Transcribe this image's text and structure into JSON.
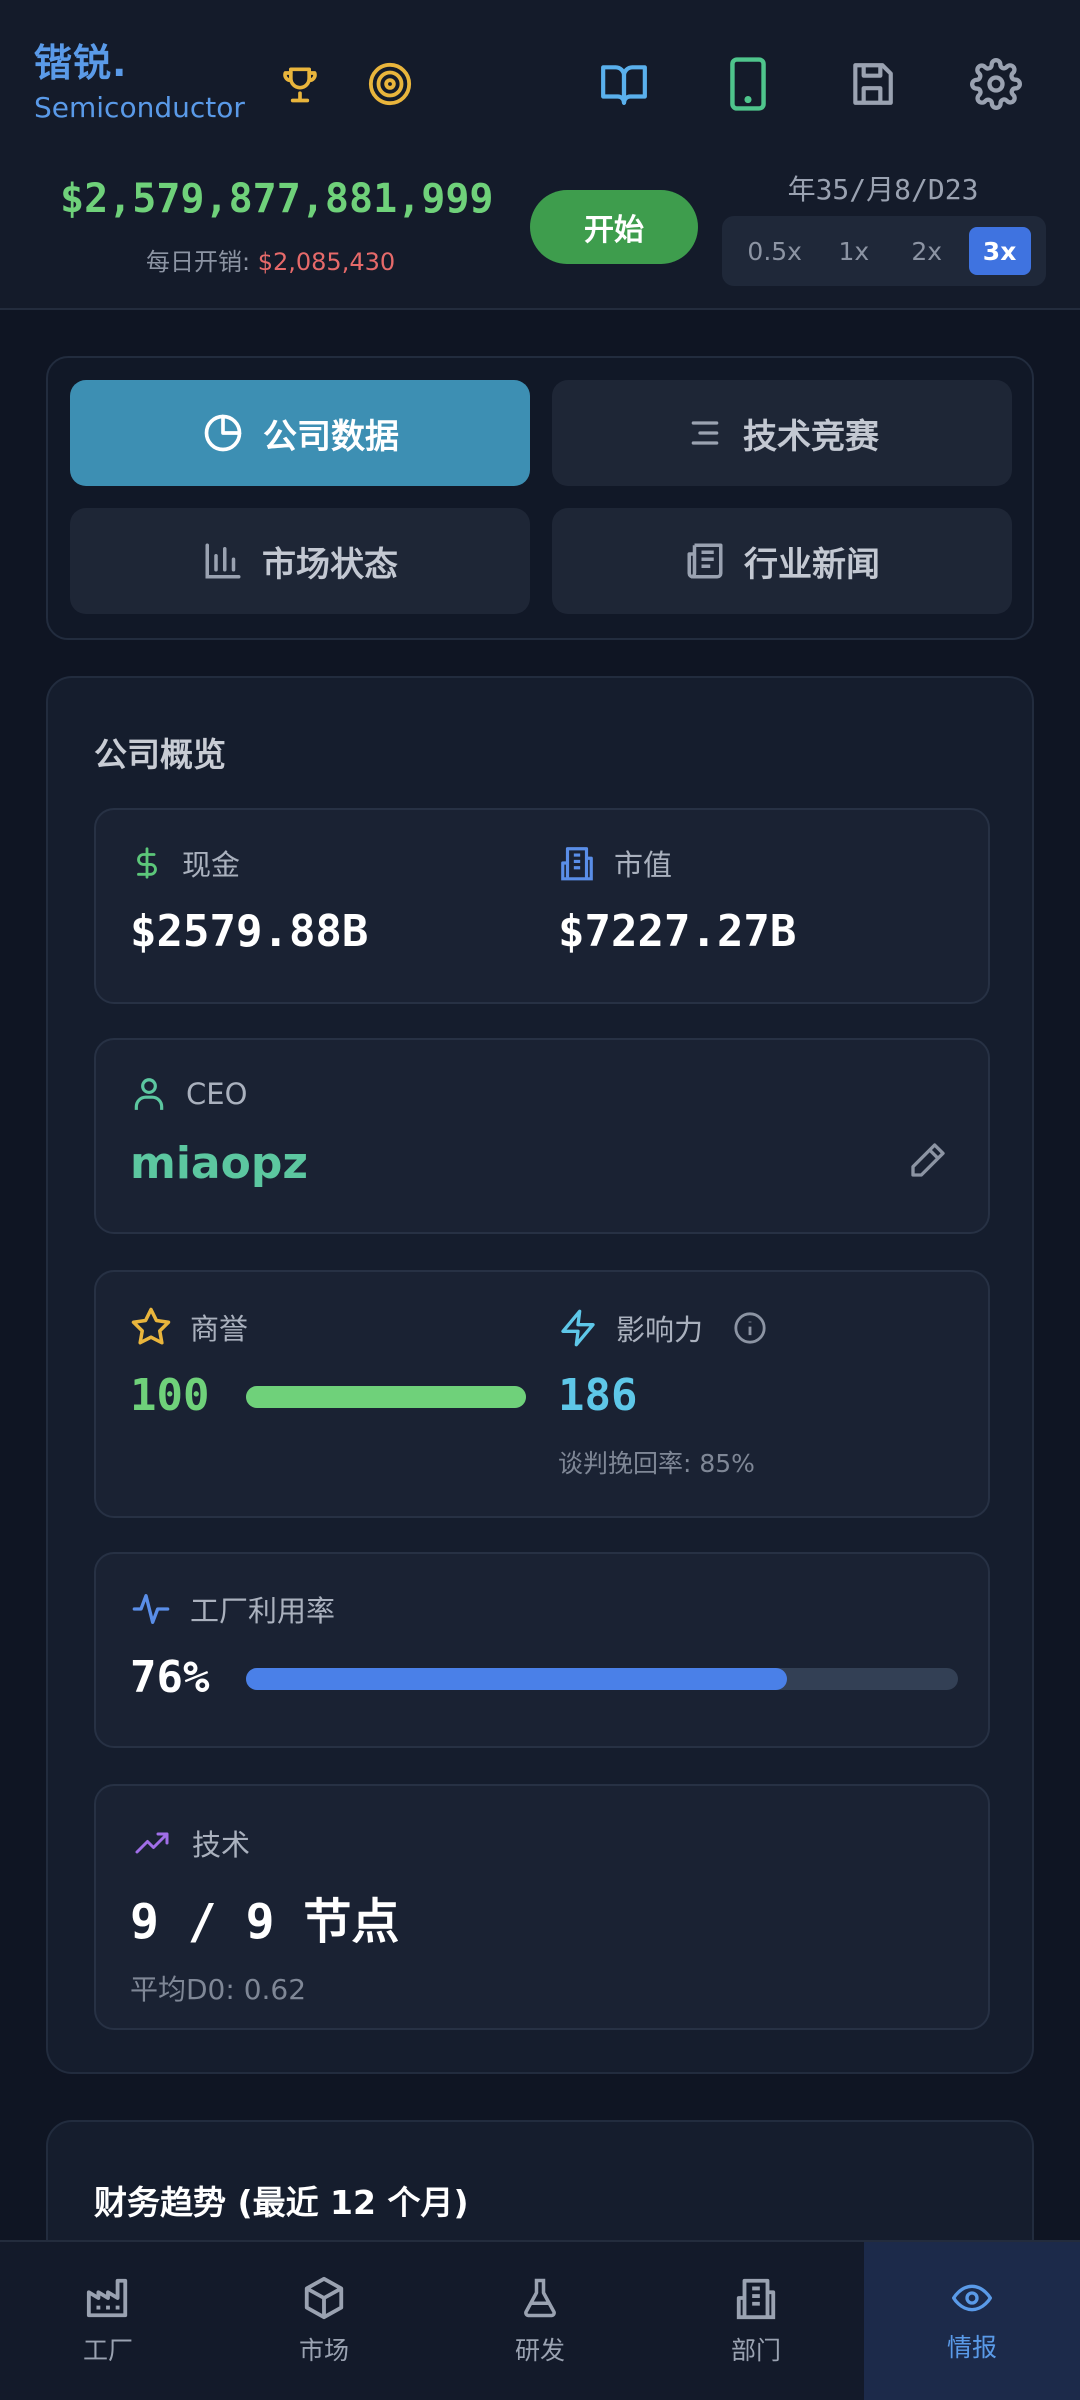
{
  "header": {
    "brand_cn": "锴锐.",
    "brand_en": "Semiconductor",
    "icons": [
      "trophy-icon",
      "target-icon",
      "book-icon",
      "tablet-icon",
      "save-icon",
      "gear-icon"
    ],
    "cash": "$2,579,877,881,999",
    "daily_label": "每日开销: ",
    "daily_value": "$2,085,430",
    "start_label": "开始",
    "date": "年35/月8/D23",
    "speeds": [
      "0.5x",
      "1x",
      "2x",
      "3x"
    ],
    "active_speed": "3x"
  },
  "tabs": {
    "company_data": "公司数据",
    "tech_race": "技术竞赛",
    "market_status": "市场状态",
    "industry_news": "行业新闻",
    "active": "公司数据"
  },
  "overview": {
    "title": "公司概览",
    "cash_label": "现金",
    "cash_value": "$2579.88B",
    "market_cap_label": "市值",
    "market_cap_value": "$7227.27B",
    "ceo_label": "CEO",
    "ceo_name": "miaopz",
    "reputation_label": "商誉",
    "reputation_value": "100",
    "reputation_fraction": 1.0,
    "influence_label": "影响力",
    "influence_value": "186",
    "negotiation_text": "谈判挽回率: 85%",
    "utilization_label": "工厂利用率",
    "utilization_value": "76%",
    "utilization_fraction": 0.76,
    "tech_label": "技术",
    "tech_value": "9 / 9 节点",
    "tech_d0": "平均D0: 0.62"
  },
  "finance": {
    "title": "财务趋势 (最近 12 个月)"
  },
  "nav": {
    "items": [
      {
        "label": "工厂",
        "icon": "factory-icon"
      },
      {
        "label": "市场",
        "icon": "box-icon"
      },
      {
        "label": "研发",
        "icon": "flask-icon"
      },
      {
        "label": "部门",
        "icon": "building-icon"
      },
      {
        "label": "情报",
        "icon": "eye-icon"
      }
    ],
    "active": "情报"
  },
  "colors": {
    "accent_blue": "#5a9ae8",
    "positive_green": "#6fd17a",
    "negative_red": "#e66a6a",
    "tab_active": "#3d8fb3",
    "utilization_bar": "#4a80e8",
    "influence_cyan": "#5ec7e8"
  }
}
